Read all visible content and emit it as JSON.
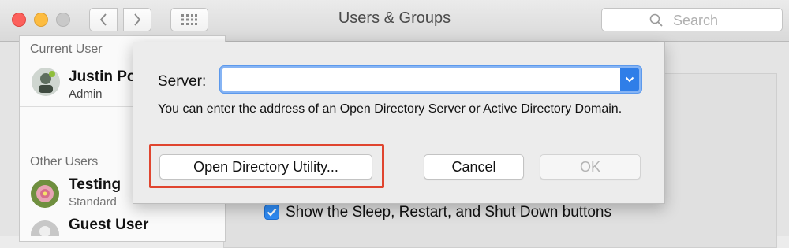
{
  "window": {
    "title": "Users & Groups",
    "search": {
      "placeholder": "Search",
      "value": ""
    }
  },
  "sidebar": {
    "current_user_header": "Current User",
    "current_user": {
      "name": "Justin Po",
      "role": "Admin"
    },
    "other_users_header": "Other Users",
    "other_users": [
      {
        "name": "Testing",
        "role": "Standard"
      },
      {
        "name": "Guest User",
        "role": ""
      }
    ]
  },
  "background": {
    "checkbox_label": "Show the Sleep, Restart, and Shut Down buttons",
    "checkbox_checked": true
  },
  "sheet": {
    "server_label": "Server:",
    "server_value": "",
    "help_text": "You can enter the address of an Open Directory Server or Active Directory Domain.",
    "buttons": {
      "open_directory_utility": "Open Directory Utility...",
      "cancel": "Cancel",
      "ok": "OK"
    }
  },
  "colors": {
    "accent": "#2f7ee8",
    "highlight_box": "#e0452f",
    "close": "#fc605c",
    "minimize": "#fdbc40"
  },
  "icons": [
    "back-chevron-icon",
    "forward-chevron-icon",
    "grid-icon",
    "search-icon",
    "chevron-down-icon",
    "checkmark-icon"
  ]
}
